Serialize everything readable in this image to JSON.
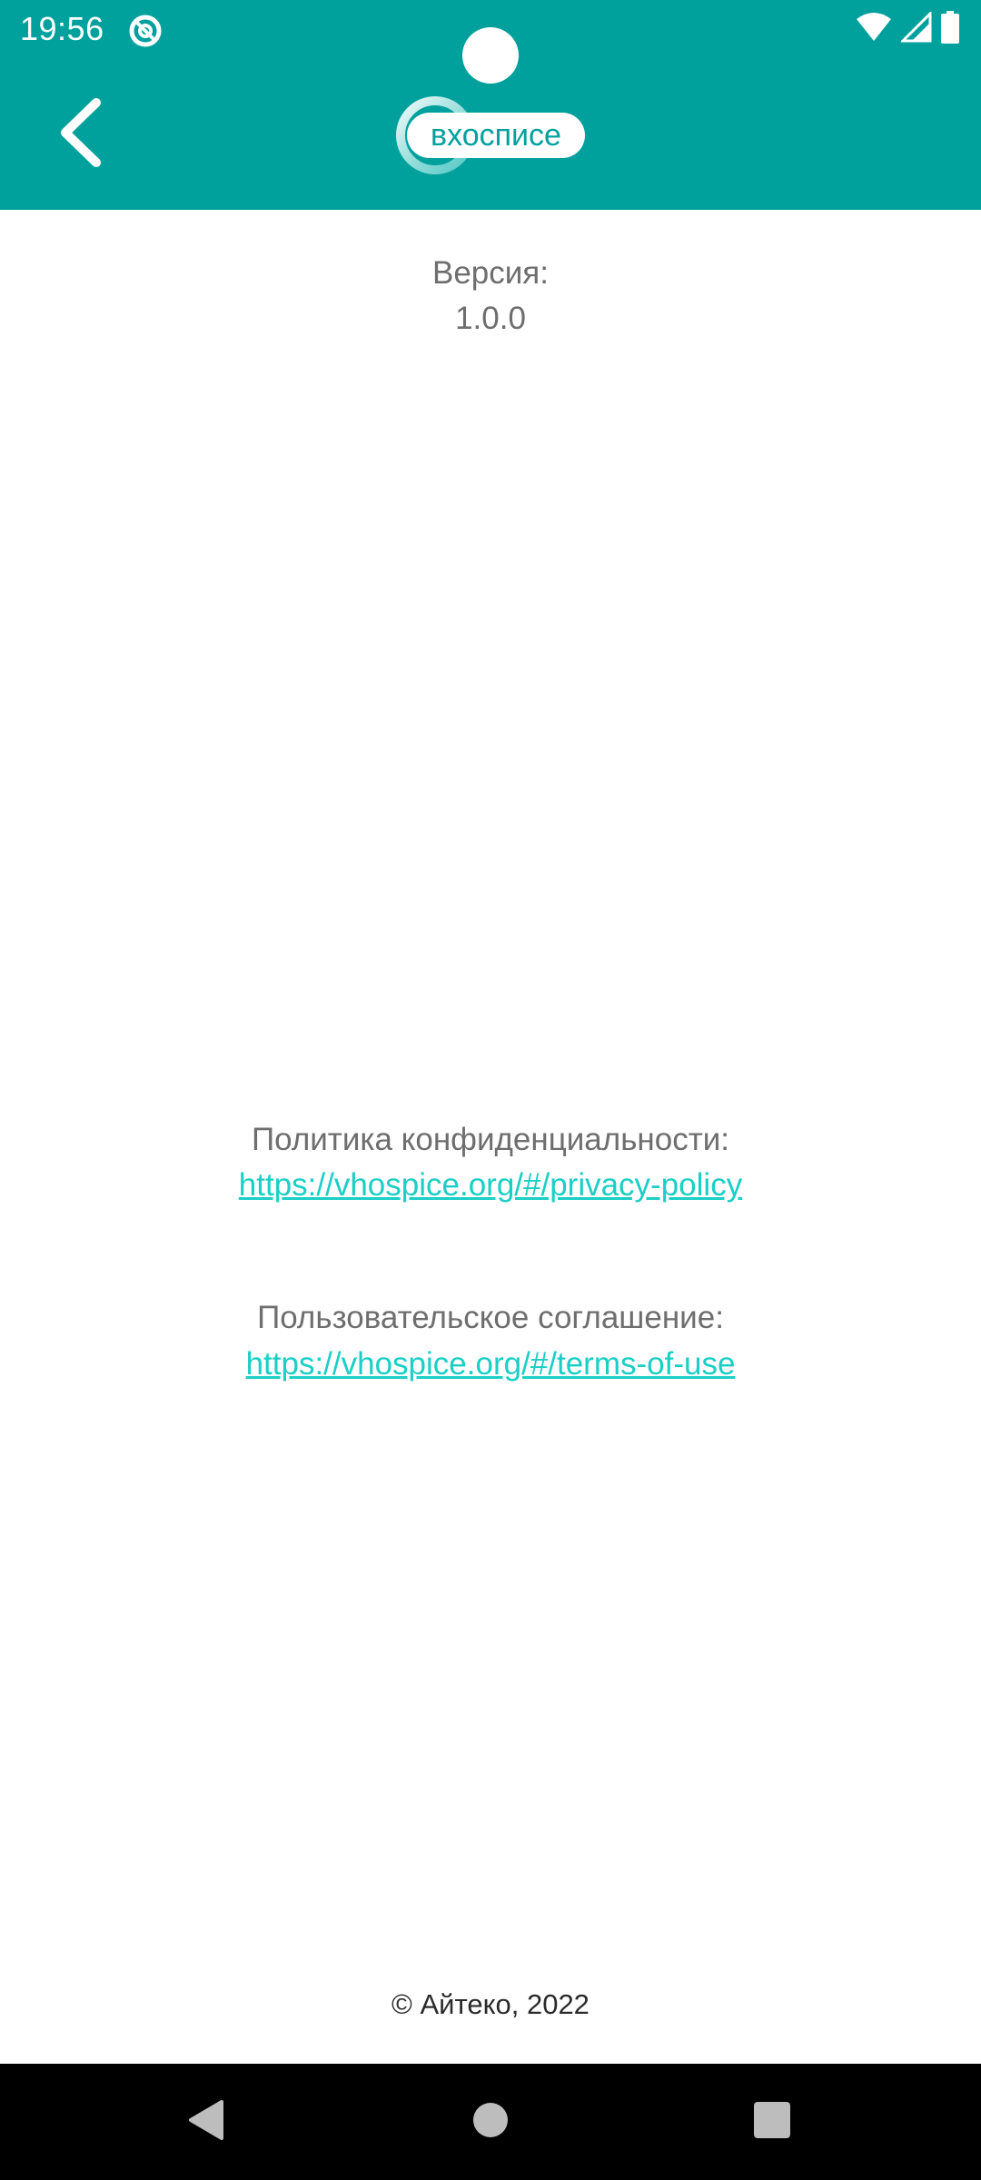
{
  "status_bar": {
    "time": "19:56",
    "icons": [
      "app-notification-icon",
      "wifi-icon",
      "cell-signal-icon",
      "battery-icon"
    ]
  },
  "app_bar": {
    "back_icon": "chevron-left-icon",
    "logo_text": "вхосписе"
  },
  "version": {
    "label": "Версия:",
    "value": "1.0.0"
  },
  "privacy": {
    "label": "Политика конфиденциальности:",
    "url": "https://vhospice.org/#/privacy-policy"
  },
  "terms": {
    "label": "Пользовательское соглашение:",
    "url": "https://vhospice.org/#/terms-of-use"
  },
  "footer": {
    "copyright": "© Айтеко, 2022"
  },
  "nav_bar": {
    "buttons": [
      "back-triangle-icon",
      "home-circle-icon",
      "recents-square-icon"
    ]
  },
  "colors": {
    "brand": "#00A19D",
    "link": "#1ACFC6",
    "text_muted": "#6e6e6e",
    "nav_background": "#000000"
  }
}
